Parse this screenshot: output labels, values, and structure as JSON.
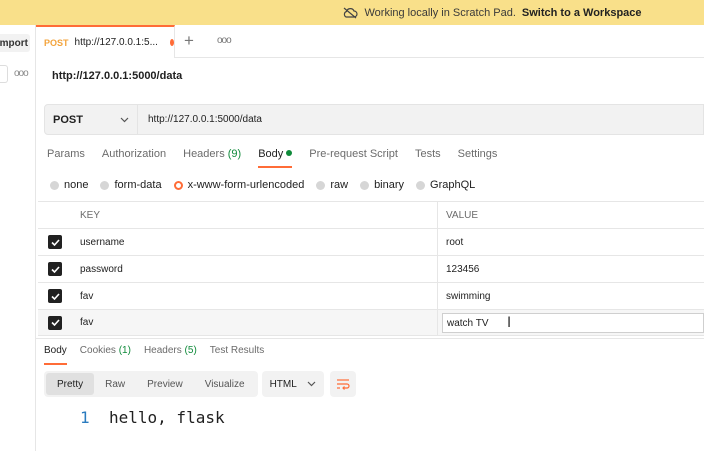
{
  "banner": {
    "text": "Working locally in Scratch Pad.",
    "link": "Switch to a Workspace"
  },
  "sidebar": {
    "import_label": "mport"
  },
  "tab": {
    "method": "POST",
    "url": "http://127.0.0.1:5..."
  },
  "request": {
    "title": "http://127.0.0.1:5000/data",
    "method": "POST",
    "url": "http://127.0.0.1:5000/data"
  },
  "subtabs": [
    {
      "label": "Params"
    },
    {
      "label": "Authorization"
    },
    {
      "label": "Headers",
      "count": "(9)"
    },
    {
      "label": "Body"
    },
    {
      "label": "Pre-request Script"
    },
    {
      "label": "Tests"
    },
    {
      "label": "Settings"
    }
  ],
  "body_types": [
    "none",
    "form-data",
    "x-www-form-urlencoded",
    "raw",
    "binary",
    "GraphQL"
  ],
  "body_type_selected": "x-www-form-urlencoded",
  "table": {
    "headers": {
      "key": "KEY",
      "value": "VALUE"
    },
    "rows": [
      {
        "key": "username",
        "value": "root",
        "checked": true
      },
      {
        "key": "password",
        "value": "123456",
        "checked": true
      },
      {
        "key": "fav",
        "value": "swimming",
        "checked": true
      },
      {
        "key": "fav",
        "value": "watch TV",
        "checked": true
      }
    ]
  },
  "response": {
    "tabs": [
      {
        "label": "Body"
      },
      {
        "label": "Cookies",
        "count": "(1)"
      },
      {
        "label": "Headers",
        "count": "(5)"
      },
      {
        "label": "Test Results"
      }
    ],
    "views": [
      "Pretty",
      "Raw",
      "Preview",
      "Visualize"
    ],
    "format": "HTML",
    "line_number": "1",
    "body_text": "hello, flask"
  },
  "colors": {
    "accent": "#ff6c37",
    "banner": "#f9e08a",
    "count_green": "#0f8a3a"
  }
}
